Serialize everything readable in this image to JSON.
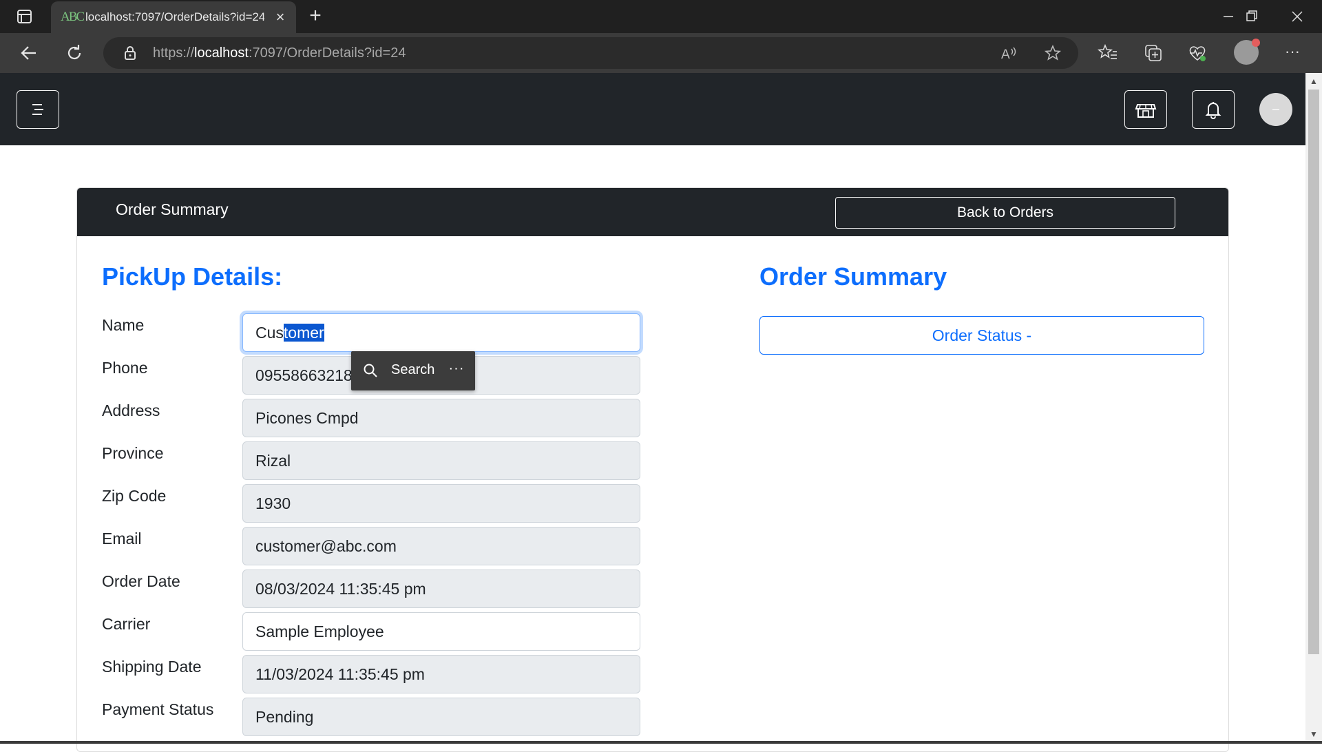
{
  "browser": {
    "tab_title": "localhost:7097/OrderDetails?id=24",
    "tab_favicon": "ABC",
    "url_prefix": "https://",
    "url_host": "localhost",
    "url_rest": ":7097/OrderDetails?id=24",
    "icons": [
      "tab-actions-icon",
      "close-icon",
      "plus-icon",
      "minimize-icon",
      "restore-icon",
      "close-window-icon",
      "back-arrow-icon",
      "refresh-icon",
      "lock-icon",
      "read-aloud-icon",
      "star-icon",
      "favorites-icon",
      "collections-icon",
      "browser-essentials-icon",
      "more-icon"
    ]
  },
  "header": {
    "icons": [
      "menu-icon",
      "store-icon",
      "bell-icon"
    ],
    "avatar_text": "–"
  },
  "card": {
    "header_title": "Order Summary",
    "back_label": "Back to Orders"
  },
  "pickup": {
    "title": "PickUp Details:",
    "fields": [
      {
        "label": "Name",
        "value_plain": "Cus",
        "value_selected": "tomer"
      },
      {
        "label": "Phone",
        "value": "09558663218"
      },
      {
        "label": "Address",
        "value": "Picones Cmpd"
      },
      {
        "label": "Province",
        "value": "Rizal"
      },
      {
        "label": "Zip Code",
        "value": "1930"
      },
      {
        "label": "Email",
        "value": "customer@abc.com"
      },
      {
        "label": "Order Date",
        "value": "08/03/2024 11:35:45 pm"
      },
      {
        "label": "Carrier",
        "value": "Sample Employee"
      },
      {
        "label": "Shipping Date",
        "value": "11/03/2024 11:35:45 pm"
      },
      {
        "label": "Payment Status",
        "value": "Pending"
      }
    ]
  },
  "summary": {
    "title": "Order Summary",
    "status_button": "Order Status -"
  },
  "selection_popup": {
    "search_label": "Search",
    "more_label": "···"
  },
  "colors": {
    "accent": "#0d6efd",
    "dark": "#212529",
    "input_readonly_bg": "#e9ecef",
    "selection": "#0b57d0"
  }
}
